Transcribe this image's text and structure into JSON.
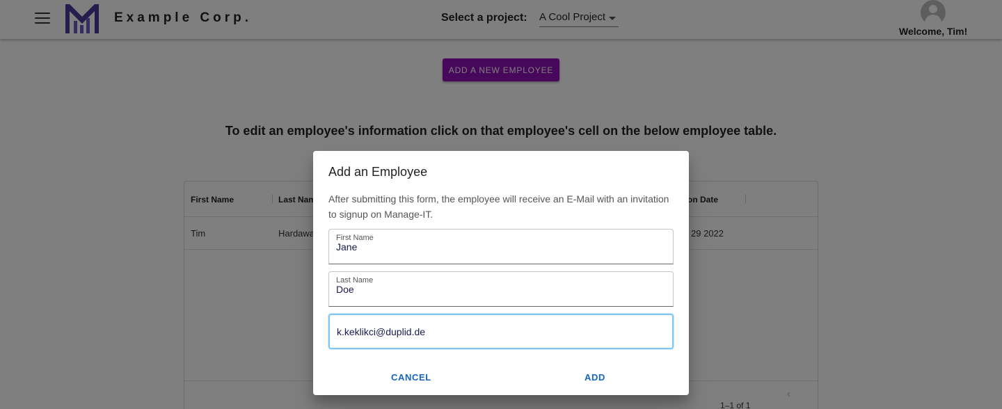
{
  "header": {
    "company_name": "Example Corp.",
    "project_label": "Select a project:",
    "project_selected": "A Cool Project",
    "welcome": "Welcome, Tim!"
  },
  "main": {
    "add_button": "ADD A NEW EMPLOYEE",
    "instruction": "To edit an employee's information click on that employee's cell on the below employee table.",
    "table": {
      "columns": [
        "First Name",
        "Last Nam",
        "on Date"
      ],
      "rows": [
        {
          "first_name": "Tim",
          "last_name": "Hardawa",
          "date": "29 2022"
        }
      ],
      "pagination": "1–1 of 1"
    }
  },
  "dialog": {
    "title": "Add an Employee",
    "description": "After submitting this form, the employee will receive an E-Mail with an invitation to signup on Manage-IT.",
    "fields": {
      "first_name": {
        "label": "First Name",
        "value": "Jane"
      },
      "last_name": {
        "label": "Last Name",
        "value": "Doe"
      },
      "email": {
        "value": "k.keklikci@duplid.de"
      }
    },
    "cancel_label": "CANCEL",
    "add_label": "ADD"
  },
  "colors": {
    "primary_button": "#8e0fb5",
    "dialog_action": "#1565c0",
    "focus_border": "#7fc7f0",
    "logo": "#4b3a9a"
  },
  "icons": [
    "menu-icon",
    "company-logo",
    "dropdown-caret-icon",
    "user-avatar-icon",
    "chevron-left-icon"
  ]
}
